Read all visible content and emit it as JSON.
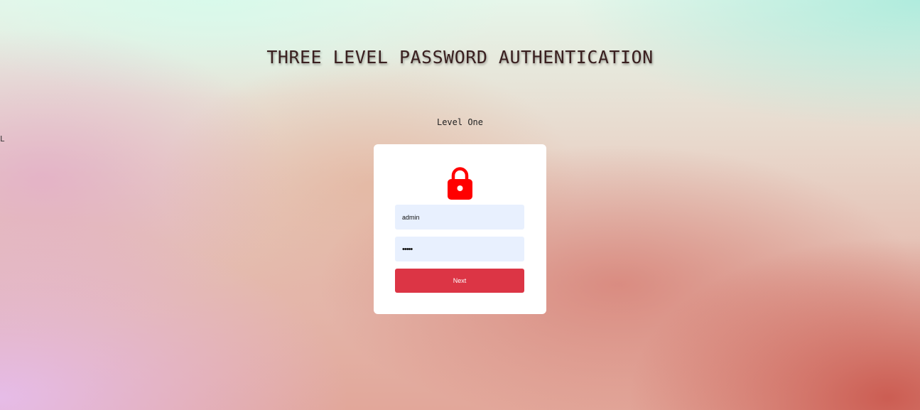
{
  "header": {
    "title": "THREE LEVEL PASSWORD AUTHENTICATION",
    "stray_text": "L"
  },
  "level": {
    "label": "Level One"
  },
  "login_card": {
    "icon": "lock-icon",
    "icon_color": "#ff0000",
    "username": {
      "value": "admin"
    },
    "password": {
      "value": "•••••"
    },
    "next_button": {
      "label": "Next",
      "color": "#dc3545"
    }
  }
}
